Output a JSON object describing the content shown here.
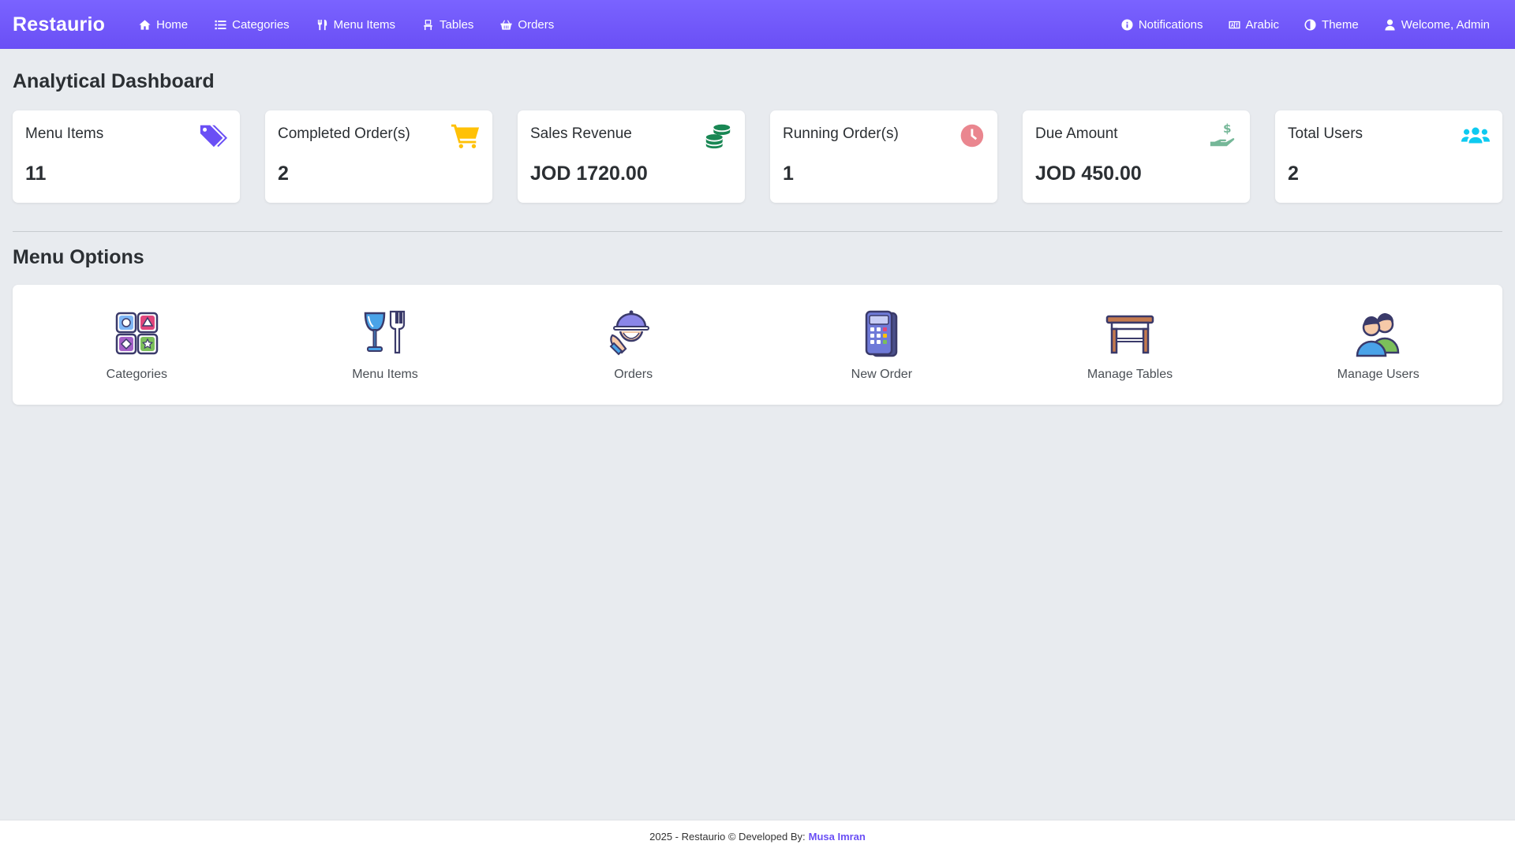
{
  "navbar": {
    "brand": "Restaurio",
    "left_items": [
      {
        "label": "Home",
        "icon": "home-icon"
      },
      {
        "label": "Categories",
        "icon": "list-icon"
      },
      {
        "label": "Menu Items",
        "icon": "utensils-icon"
      },
      {
        "label": "Tables",
        "icon": "chair-icon"
      },
      {
        "label": "Orders",
        "icon": "basket-icon"
      }
    ],
    "right_items": [
      {
        "label": "Notifications",
        "icon": "info-circle-icon"
      },
      {
        "label": "Arabic",
        "icon": "language-icon"
      },
      {
        "label": "Theme",
        "icon": "half-circle-icon"
      },
      {
        "label": "Welcome, Admin",
        "icon": "user-icon"
      }
    ]
  },
  "dashboard": {
    "title": "Analytical Dashboard",
    "stats": [
      {
        "label": "Menu Items",
        "value": "11",
        "icon": "tags-icon",
        "color": "#6a4ff5"
      },
      {
        "label": "Completed Order(s)",
        "value": "2",
        "icon": "cart-icon",
        "color": "#ffc107"
      },
      {
        "label": "Sales Revenue",
        "value": "JOD 1720.00",
        "icon": "coins-icon",
        "color": "#198754"
      },
      {
        "label": "Running Order(s)",
        "value": "1",
        "icon": "clock-icon",
        "color": "#ea868f"
      },
      {
        "label": "Due Amount",
        "value": "JOD 450.00",
        "icon": "hand-dollar-icon",
        "color": "#75b798"
      },
      {
        "label": "Total Users",
        "value": "2",
        "icon": "users-icon",
        "color": "#0dcaf0"
      }
    ]
  },
  "menu_options": {
    "title": "Menu Options",
    "items": [
      {
        "label": "Categories",
        "icon": "categories-grid-icon"
      },
      {
        "label": "Menu Items",
        "icon": "glass-fork-icon"
      },
      {
        "label": "Orders",
        "icon": "waiter-cloche-icon"
      },
      {
        "label": "New Order",
        "icon": "pos-terminal-icon"
      },
      {
        "label": "Manage Tables",
        "icon": "table-icon"
      },
      {
        "label": "Manage Users",
        "icon": "two-users-icon"
      }
    ]
  },
  "footer": {
    "text": "2025 - Restaurio © Developed By:",
    "developer": "Musa Imran"
  }
}
